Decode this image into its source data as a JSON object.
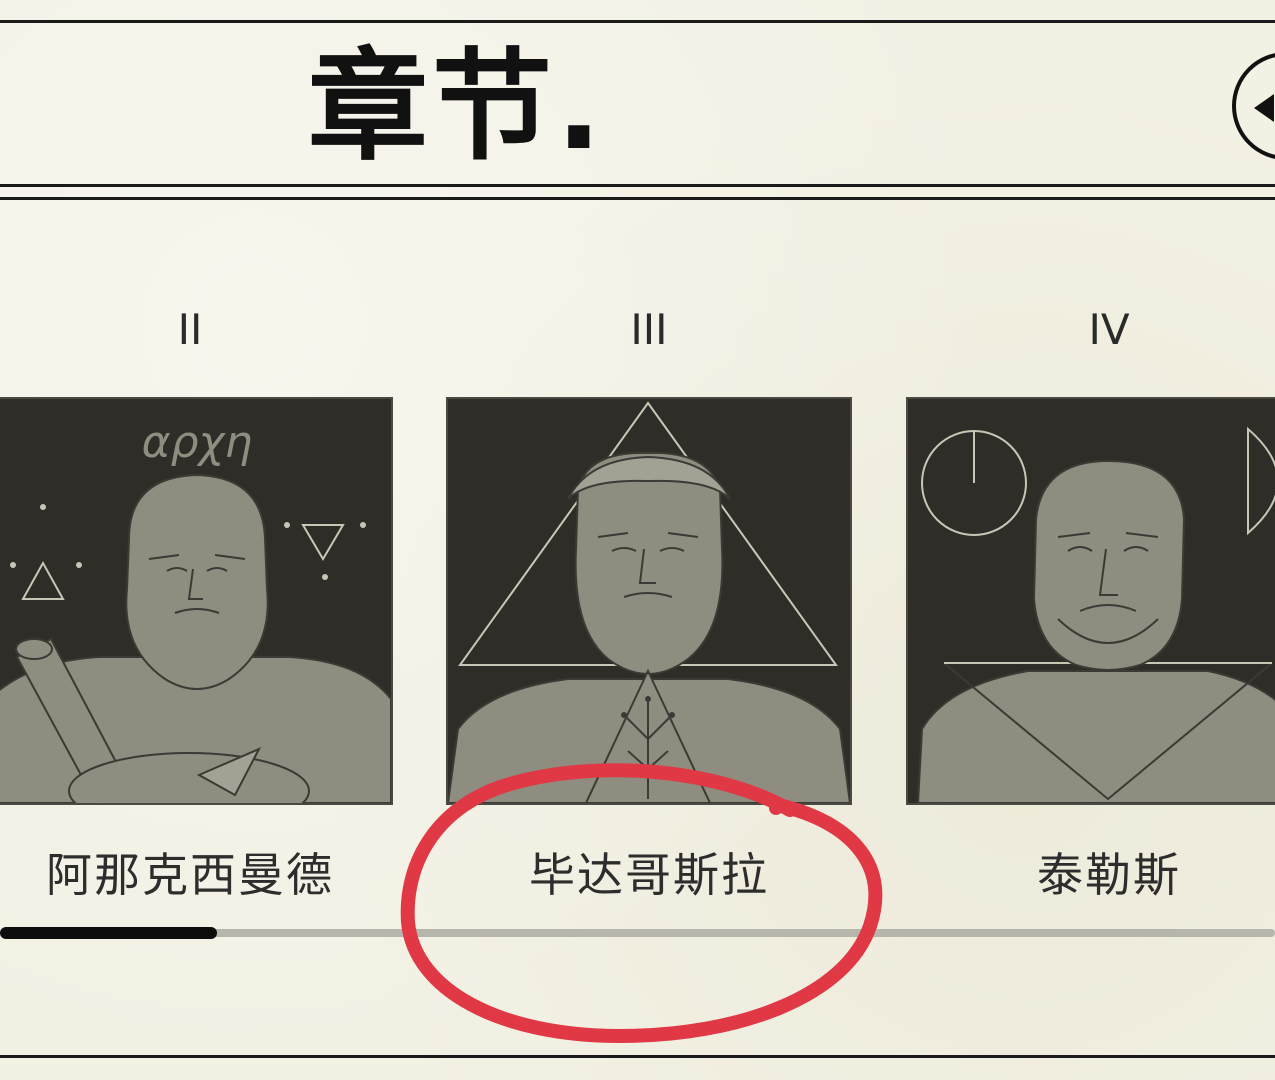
{
  "header": {
    "title": "章节."
  },
  "chapters": [
    {
      "numeral": "II",
      "name": "阿那克西曼德",
      "symbol_text": "αρχη"
    },
    {
      "numeral": "III",
      "name": "毕达哥斯拉"
    },
    {
      "numeral": "IV",
      "name": "泰勒斯"
    }
  ],
  "scroll": {
    "progress": 0.17
  },
  "colors": {
    "background": "#f3f1e4",
    "card": "#2e2d28",
    "figure": "#8f8d80",
    "line": "#d6d3c4",
    "text": "#111111",
    "annotation": "#e03844"
  },
  "icons": {
    "back": "back-arrow-icon"
  }
}
